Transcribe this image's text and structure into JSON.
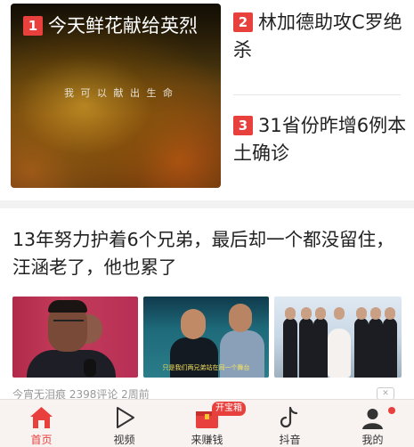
{
  "hot_list": {
    "featured": {
      "rank": "1",
      "title": "今天鲜花献给英烈",
      "image_caption": "我 可 以 献 出 生 命"
    },
    "items": [
      {
        "rank": "2",
        "title": "林加德助攻C罗绝杀"
      },
      {
        "rank": "3",
        "title": "31省份昨增6例本土确诊"
      }
    ]
  },
  "article": {
    "title": "13年努力护着6个兄弟，最后却一个都没留住，汪涵老了，他也累了",
    "thumb2_subtitle": "只是我们两兄弟站在同一个舞台",
    "meta": "今宵无泪痕  2398评论  2周前",
    "close_glyph": "✕"
  },
  "tabbar": {
    "items": [
      {
        "label": "首页",
        "icon": "home-icon",
        "active": true
      },
      {
        "label": "视频",
        "icon": "play-icon"
      },
      {
        "label": "来赚钱",
        "icon": "treasure-box-icon",
        "badge": "开宝箱"
      },
      {
        "label": "抖音",
        "icon": "douyin-icon"
      },
      {
        "label": "我的",
        "icon": "user-icon",
        "dot": true
      }
    ]
  },
  "colors": {
    "accent": "#e8403d",
    "tab_background": "#f8f3f1"
  }
}
